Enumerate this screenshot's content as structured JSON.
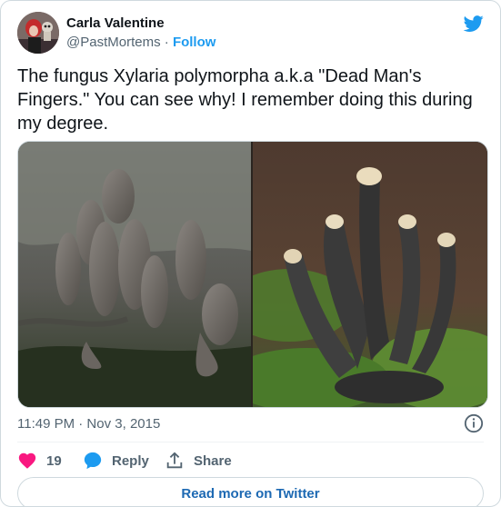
{
  "tweet": {
    "author": {
      "name": "Carla Valentine",
      "handle": "@PastMortems",
      "separator": "·",
      "follow_label": "Follow",
      "avatar_icon": "avatar-photo"
    },
    "text": "The fungus Xylaria polymorpha a.k.a \"Dead Man's Fingers.\" You can see why! I remember doing this during my degree.",
    "media": [
      "fungus-photo-left",
      "fungus-photo-right"
    ],
    "timestamp": "11:49 PM · Nov 3, 2015",
    "actions": {
      "like_count": "19",
      "reply_label": "Reply",
      "share_label": "Share"
    },
    "read_more_label": "Read more on Twitter"
  },
  "colors": {
    "brand": "#1d9bf0",
    "like": "#f91880",
    "reply": "#1d9bf0",
    "text": "#0f1419",
    "muted": "#536471"
  },
  "icons": [
    "twitter-bird-icon",
    "info-icon",
    "heart-icon",
    "reply-bubble-icon",
    "share-icon"
  ]
}
